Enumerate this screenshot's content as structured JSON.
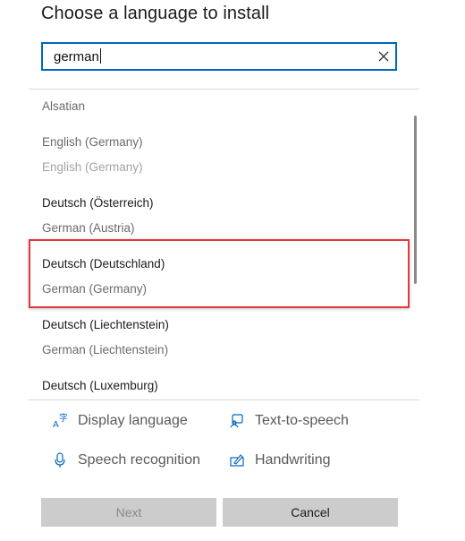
{
  "dialog": {
    "title": "Choose a language to install"
  },
  "search": {
    "value": "german"
  },
  "list": {
    "items": [
      {
        "text": "Alsatian",
        "style": "secondary"
      },
      {
        "text": "English (Germany)",
        "style": "secondary"
      },
      {
        "text": "English (Germany)",
        "style": "faint"
      },
      {
        "text": "Deutsch (Österreich)",
        "style": "primary"
      },
      {
        "text": "German (Austria)",
        "style": "secondary"
      },
      {
        "text": "Deutsch (Deutschland)",
        "style": "primary"
      },
      {
        "text": "German (Germany)",
        "style": "secondary"
      },
      {
        "text": "Deutsch (Liechtenstein)",
        "style": "primary"
      },
      {
        "text": "German (Liechtenstein)",
        "style": "secondary"
      },
      {
        "text": "Deutsch (Luxemburg)",
        "style": "primary"
      }
    ]
  },
  "features": {
    "display_language": "Display language",
    "text_to_speech": "Text-to-speech",
    "speech_recognition": "Speech recognition",
    "handwriting": "Handwriting"
  },
  "buttons": {
    "next": "Next",
    "cancel": "Cancel"
  },
  "colors": {
    "accent": "#0067c0",
    "highlight_border": "#e0393e",
    "icon": "#0067c0"
  }
}
